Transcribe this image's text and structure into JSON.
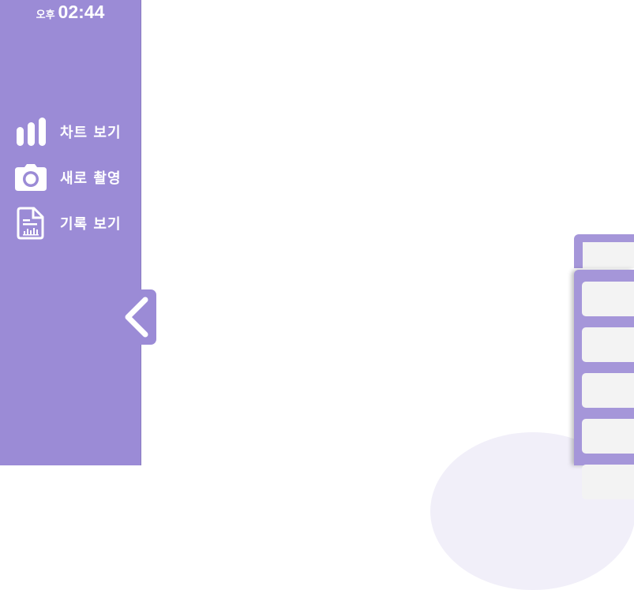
{
  "clock": {
    "ampm": "오후",
    "time": "02:44"
  },
  "nav": {
    "items": [
      {
        "label": "차트 보기",
        "icon": "bar-chart-icon"
      },
      {
        "label": "새로 촬영",
        "icon": "camera-icon"
      },
      {
        "label": "기록 보기",
        "icon": "report-document-icon"
      }
    ]
  },
  "colors": {
    "sidebar": "#9b8bd6",
    "panel": "#a596d9",
    "cell": "#f3f3f3",
    "text": "#ffffff"
  }
}
